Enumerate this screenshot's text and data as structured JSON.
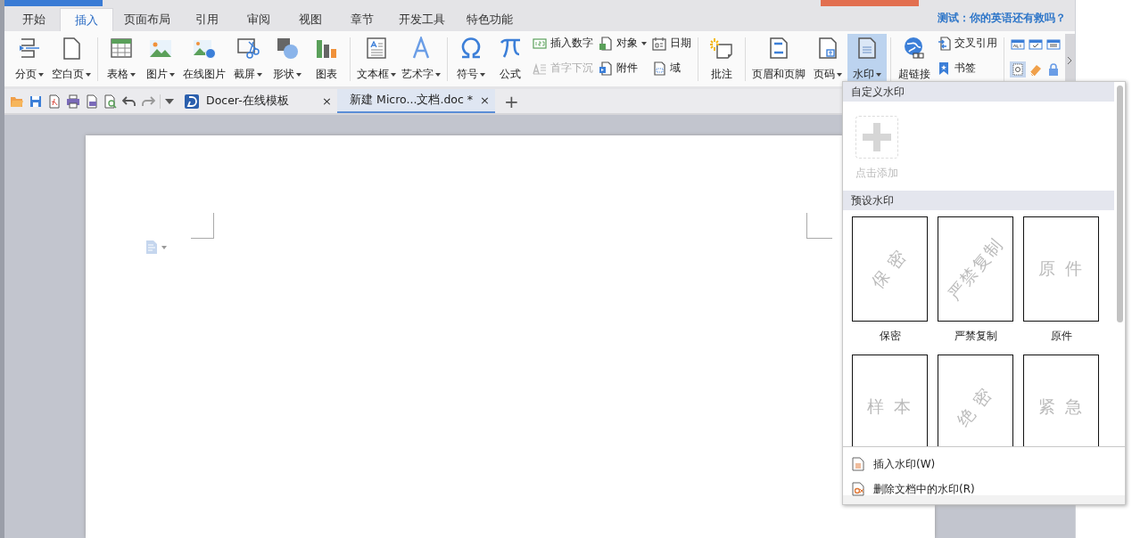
{
  "menu_tabs": [
    {
      "label": "开始",
      "selected": false
    },
    {
      "label": "插入",
      "selected": true
    },
    {
      "label": "页面布局",
      "selected": false
    },
    {
      "label": "引用",
      "selected": false
    },
    {
      "label": "审阅",
      "selected": false
    },
    {
      "label": "视图",
      "selected": false
    },
    {
      "label": "章节",
      "selected": false
    },
    {
      "label": "开发工具",
      "selected": false
    },
    {
      "label": "特色功能",
      "selected": false
    }
  ],
  "promo_link": "测试：你的英语还有救吗？",
  "ribbon": {
    "groups": [
      {
        "items": [
          {
            "kind": "large",
            "label": "分页",
            "dropdown": true
          },
          {
            "kind": "large",
            "label": "空白页",
            "dropdown": true
          }
        ]
      },
      {
        "items": [
          {
            "kind": "large",
            "label": "表格",
            "dropdown": true
          },
          {
            "kind": "large",
            "label": "图片",
            "dropdown": true
          },
          {
            "kind": "large",
            "label": "在线图片",
            "dropdown": false
          },
          {
            "kind": "large",
            "label": "截屏",
            "dropdown": true
          },
          {
            "kind": "large",
            "label": "形状",
            "dropdown": true
          },
          {
            "kind": "large",
            "label": "图表",
            "dropdown": false
          }
        ]
      },
      {
        "items": [
          {
            "kind": "large",
            "label": "文本框",
            "dropdown": true
          },
          {
            "kind": "large",
            "label": "艺术字",
            "dropdown": true
          }
        ]
      },
      {
        "items": [
          {
            "kind": "large",
            "label": "符号",
            "dropdown": true
          },
          {
            "kind": "large",
            "label": "公式",
            "dropdown": false
          },
          {
            "kind": "stack",
            "children": [
              {
                "label": "插入数字",
                "dropdown": false,
                "disabled": false
              },
              {
                "label": "首字下沉",
                "dropdown": false,
                "disabled": true
              }
            ]
          },
          {
            "kind": "stack",
            "children": [
              {
                "label": "对象",
                "dropdown": true,
                "disabled": false
              },
              {
                "label": "附件",
                "dropdown": false,
                "disabled": false
              }
            ]
          },
          {
            "kind": "stack",
            "children": [
              {
                "label": "日期",
                "dropdown": false,
                "disabled": false
              },
              {
                "label": "域",
                "dropdown": false,
                "disabled": false
              }
            ]
          }
        ]
      },
      {
        "items": [
          {
            "kind": "large",
            "label": "批注",
            "dropdown": false
          }
        ]
      },
      {
        "items": [
          {
            "kind": "large",
            "label": "页眉和页脚",
            "dropdown": false
          },
          {
            "kind": "large",
            "label": "页码",
            "dropdown": true
          },
          {
            "kind": "large",
            "label": "水印",
            "dropdown": true,
            "selected": true
          }
        ]
      },
      {
        "items": [
          {
            "kind": "large",
            "label": "超链接",
            "dropdown": false
          },
          {
            "kind": "stack",
            "children": [
              {
                "label": "交叉引用",
                "dropdown": false,
                "disabled": false
              },
              {
                "label": "书签",
                "dropdown": false,
                "disabled": false
              }
            ]
          }
        ]
      },
      {
        "items": [
          {
            "kind": "icons"
          }
        ]
      }
    ]
  },
  "doc_tabs": [
    {
      "label": "Docer-在线模板",
      "close": "×",
      "selected": false
    },
    {
      "label": "新建 Micro...文档.doc *",
      "close": "×",
      "selected": true
    }
  ],
  "new_tab": "+",
  "watermark_menu": {
    "custom_header": "自定义水印",
    "add_label": "点击添加",
    "preset_header": "预设水印",
    "presets": [
      {
        "text": "保 密",
        "label": "保密"
      },
      {
        "text": "严禁复制",
        "label": "严禁复制"
      },
      {
        "text": "原 件",
        "label": "原件"
      },
      {
        "text": "样 本"
      },
      {
        "text": "绝 密"
      },
      {
        "text": "紧 急"
      }
    ],
    "actions": [
      "插入水印(W)",
      "删除文档中的水印(R)"
    ]
  }
}
